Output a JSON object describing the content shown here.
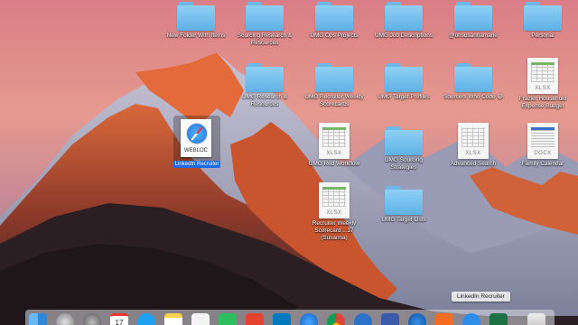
{
  "desktop_icons": {
    "new_folder_items": "New Folder With Items",
    "sourcing_research": "Sourcing Research & Resources",
    "umg_ops_projects": "UMG Ops Projects",
    "umg_job_descriptions": "UMG Job Descriptions",
    "ohsusannamarie": "@ohsusannamarie",
    "personal": "Personal",
    "umg_research": "UMG Research & Resources",
    "umg_recruiter_weekly_scorecards": "UMG Recruiter Weekly Scorecards",
    "umg_target_profiles": "UMG Target Profiles",
    "sourcers_who_code": "Sourcers Who Code 😀",
    "frazier_budget": "Frazier Household Expense Budget",
    "umg_red_workflow": "UMG Red Workflow",
    "umg_sourcing_strategies": "UMG Sourcing Strategies",
    "advanced_search": "Advanced Search",
    "family_calendar": "Family Calendar",
    "linkedin_recruiter": "LinkedIn Recruiter",
    "recruiter_weekly_scorecard": "Recruiter Weekly Scorecard ...17 (Susanna)",
    "umg_target_lists": "UMG Target Lists"
  },
  "file_ext": {
    "xlsx": "XLSX",
    "docx": "DOCX",
    "webloc": "WEBLOC"
  },
  "tooltip": "LinkedIn Recruiter",
  "dock": {
    "apps": [
      "finder-icon",
      "launchpad-icon",
      "system-preferences-icon",
      "calendar-icon",
      "twitter-icon",
      "notes-icon",
      "textedit-icon",
      "evernote-icon",
      "todoist-icon",
      "trello-icon",
      "safari-icon",
      "chrome-icon",
      "1password-icon",
      "slack-icon",
      "outlook-icon",
      "office-icon",
      "app-store-icon",
      "excel-icon",
      "trash-icon"
    ],
    "calendar_date": "17"
  },
  "colors": {
    "folder": "#7cc4f0",
    "selection": "#1d6ae5"
  }
}
